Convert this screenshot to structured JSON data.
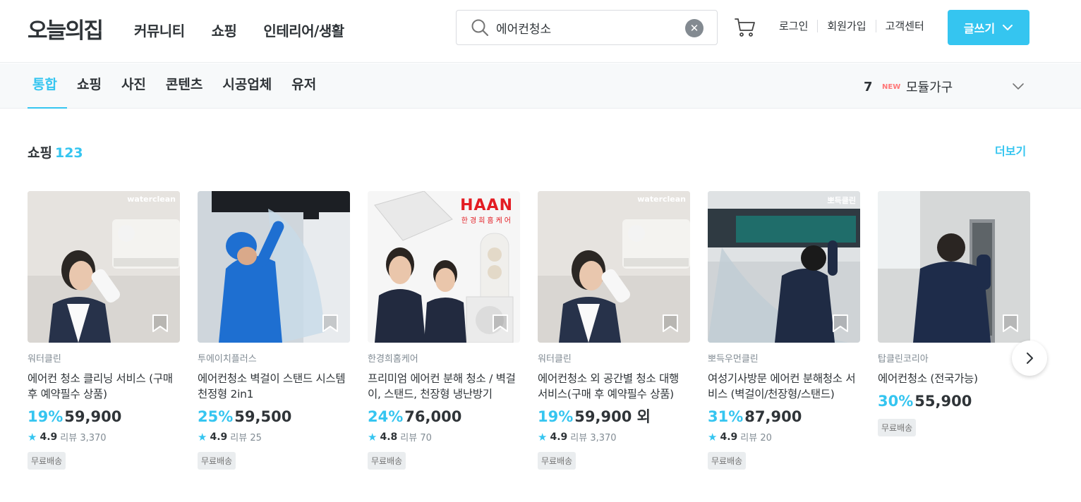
{
  "header": {
    "logo": "오늘의집",
    "nav": [
      "커뮤니티",
      "쇼핑",
      "인테리어/생활"
    ],
    "search": {
      "value": "에어컨청소",
      "clear": "✕"
    },
    "util": [
      "로그인",
      "회원가입",
      "고객센터"
    ],
    "write_button": "글쓰기"
  },
  "subnav": {
    "tabs": [
      "통합",
      "쇼핑",
      "사진",
      "콘텐츠",
      "시공업체",
      "유저"
    ],
    "active_tab": "통합",
    "ranking": {
      "rank": "7",
      "badge": "NEW",
      "keyword": "모듈가구"
    }
  },
  "section": {
    "title": "쇼핑",
    "count": "123",
    "more": "더보기"
  },
  "products": [
    {
      "brand": "워터클린",
      "name": "에어컨 청소 클리닝 서비스 (구매 후 예약필수 상품)",
      "discount": "19%",
      "price": "59,900",
      "rating": "4.9",
      "review": "리뷰 3,370",
      "badge": "무료배송",
      "watermark": "waterclean"
    },
    {
      "brand": "투에이치플러스",
      "name": "에어컨청소 벽걸이 스탠드 시스템 천정형 2in1",
      "discount": "25%",
      "price": "59,500",
      "rating": "4.9",
      "review": "리뷰 25",
      "badge": "무료배송",
      "watermark": ""
    },
    {
      "brand": "한경희홈케어",
      "name": "프리미엄 에어컨 분해 청소 / 벽걸이, 스탠드, 천장형 냉난방기",
      "discount": "24%",
      "price": "76,000",
      "rating": "4.8",
      "review": "리뷰 70",
      "badge": "무료배송",
      "watermark": "HAAN",
      "watermark_sub": "한경희홈케어"
    },
    {
      "brand": "워터클린",
      "name": "에어컨청소 외 공간별 청소 대행 서비스(구매 후 예약필수 상품)",
      "discount": "19%",
      "price": "59,900 외",
      "rating": "4.9",
      "review": "리뷰 3,370",
      "badge": "무료배송",
      "watermark": "waterclean"
    },
    {
      "brand": "뽀득우먼클린",
      "name": "여성기사방문 에어컨 분해청소 서비스 (벽걸이/천장형/스탠드)",
      "discount": "31%",
      "price": "87,900",
      "rating": "4.9",
      "review": "리뷰 20",
      "badge": "무료배송",
      "watermark": "뽀득클린"
    },
    {
      "brand": "탑클린코리아",
      "name": "에어컨청소 (전국가능)",
      "discount": "30%",
      "price": "55,900",
      "rating": "",
      "review": "",
      "badge": "무료배송",
      "watermark": ""
    }
  ],
  "colors": {
    "accent": "#35c5f0",
    "text": "#2f3438",
    "muted": "#828c94"
  }
}
